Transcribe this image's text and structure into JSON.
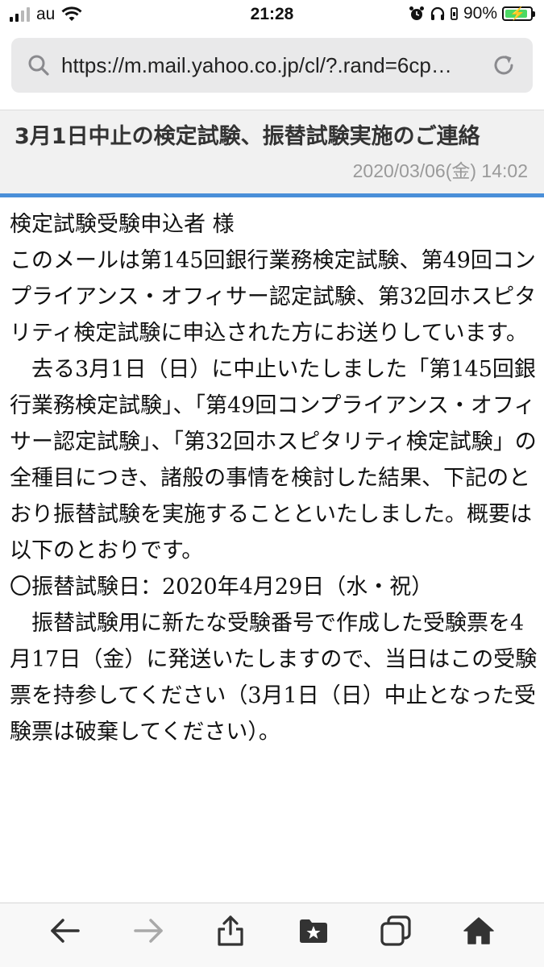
{
  "status_bar": {
    "carrier": "au",
    "time": "21:28",
    "battery_percent": "90%",
    "battery_level": 0.9,
    "icons": [
      "signal-bars-icon",
      "wifi-icon",
      "alarm-icon",
      "headphones-icon",
      "orientation-lock-icon",
      "battery-charging-icon"
    ]
  },
  "browser": {
    "url": "https://m.mail.yahoo.co.jp/cl/?.rand=6cp…",
    "search_icon": "magnifier-icon",
    "reload_icon": "reload-icon"
  },
  "mail": {
    "subject": "3月1日中止の検定試験、振替試験実施のご連絡",
    "date": "2020/03/06(金) 14:02",
    "accent_color": "#4a8fd8",
    "body": [
      "検定試験受験申込者 様",
      "",
      "",
      "このメールは第145回銀行業務検定試験、第49回コンプライアンス・オフィサー認定試験、第32回ホスピタリティ検定試験に申込された方にお送りしています。",
      "",
      "　去る3月1日（日）に中止いたしました「第145回銀行業務検定試験」、「第49回コンプライアンス・オフィサー認定試験」、「第32回ホスピタリティ検定試験」の全種目につき、諸般の事情を検討した結果、下記のとおり振替試験を実施することといたしました。概要は以下のとおりです。",
      "",
      "〇振替試験日：2020年4月29日（水・祝）",
      "　振替試験用に新たな受験番号で作成した受験票を4月17日（金）に発送いたしますので、当日はこの受験票を持参してください（3月1日（日）中止となった受験票は破棄してください）。"
    ]
  },
  "toolbar": {
    "icons": [
      "back-arrow-icon",
      "forward-arrow-icon",
      "share-icon",
      "bookmarks-icon",
      "tabs-icon",
      "home-icon"
    ]
  }
}
